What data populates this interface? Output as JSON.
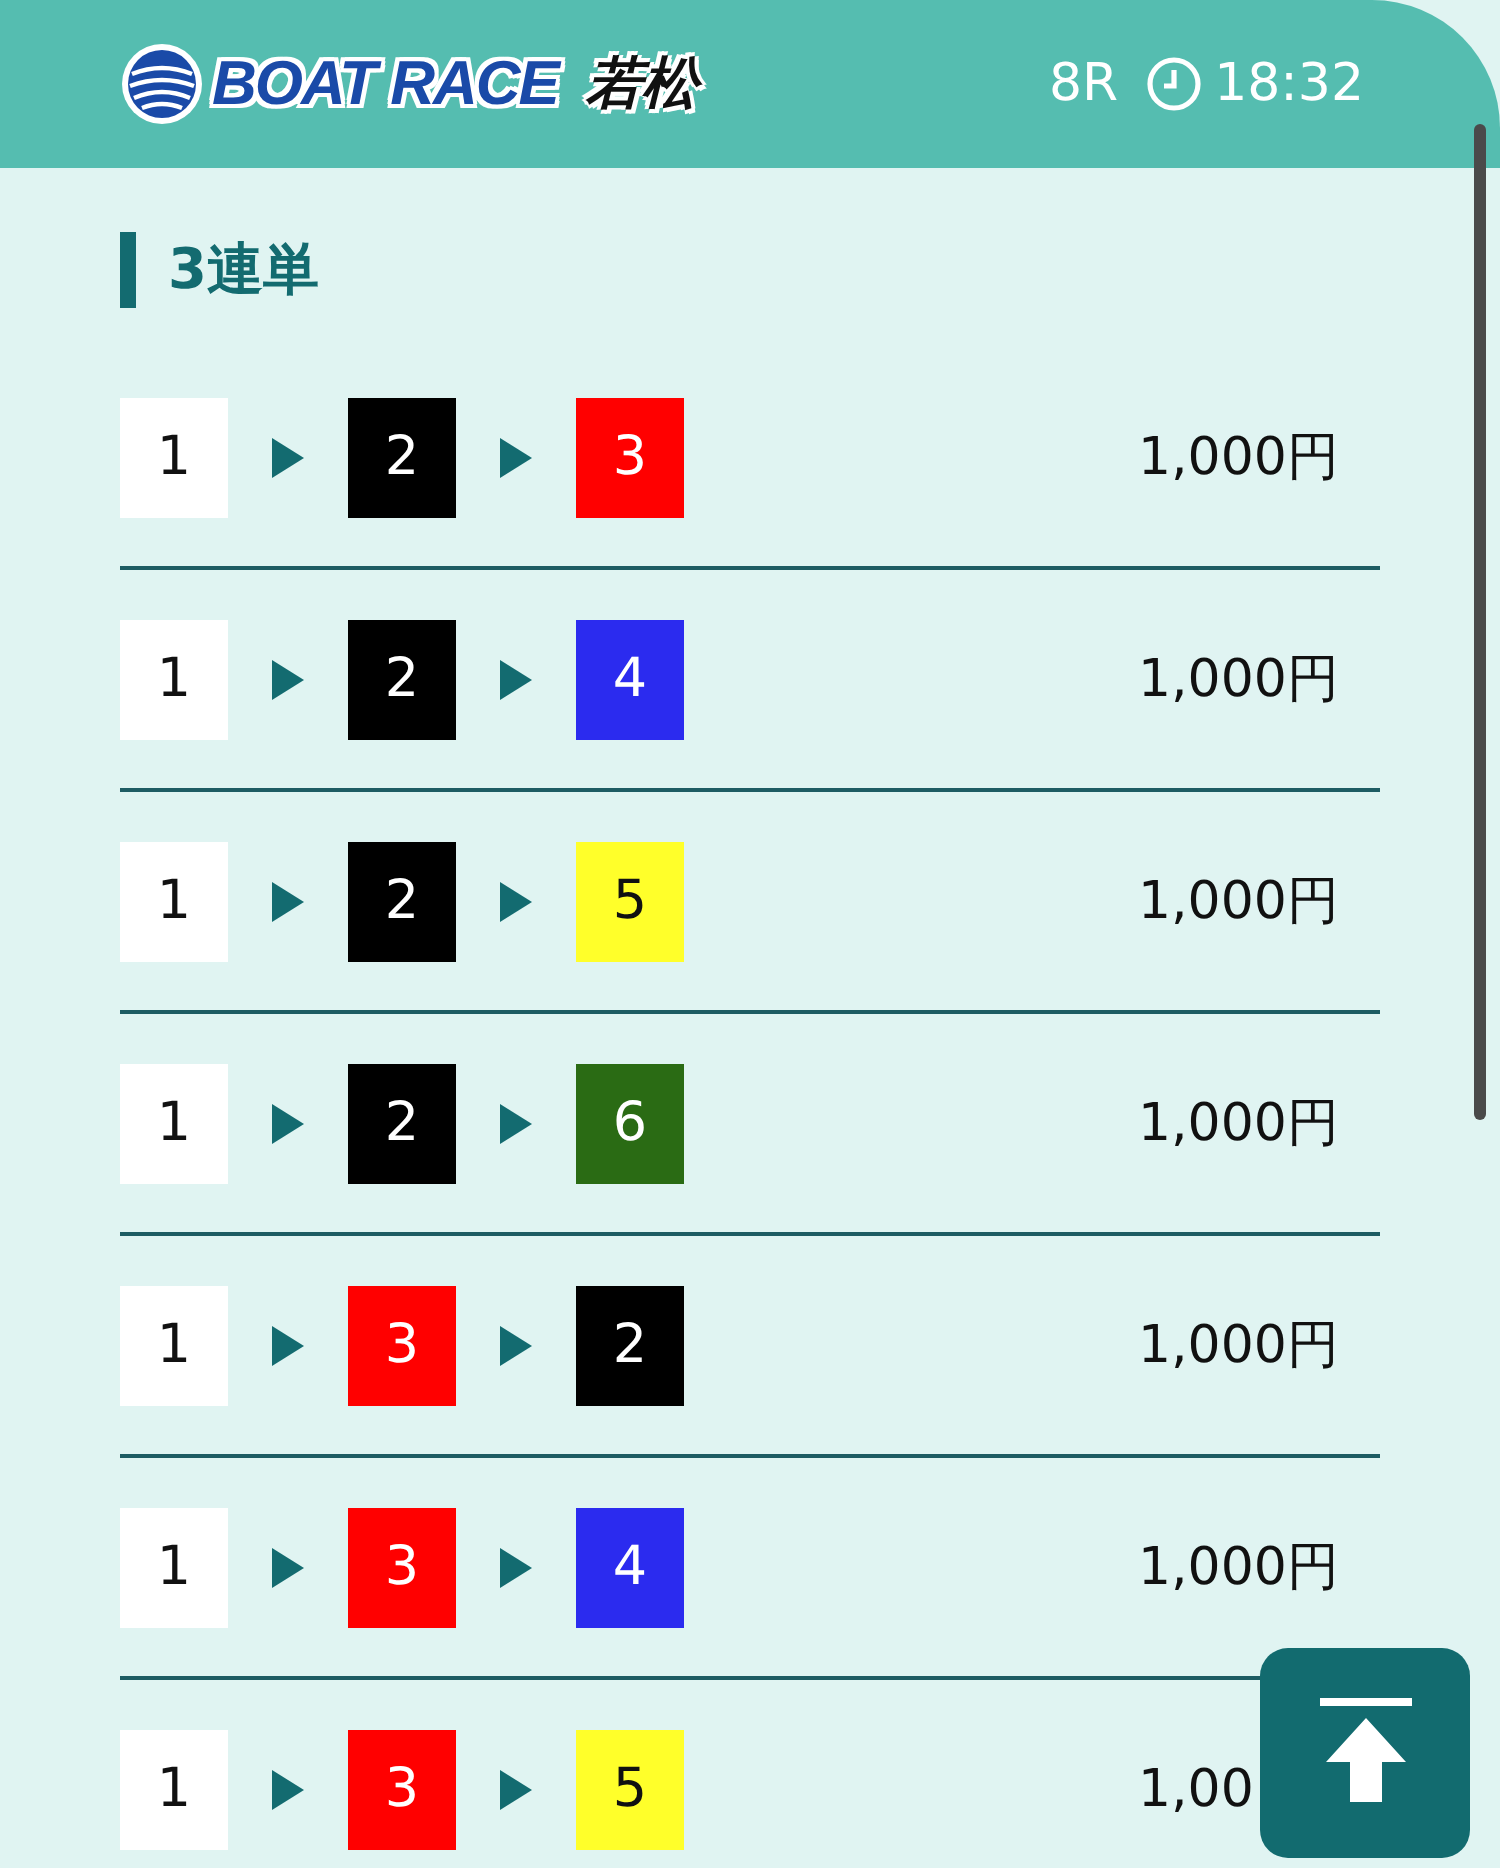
{
  "header": {
    "logo": {
      "brand": "BOAT RACE",
      "venue": "若松"
    },
    "race": "8R",
    "time": "18:32"
  },
  "section_title": "3連単",
  "bets": [
    {
      "boats": [
        {
          "number": "1",
          "color": "#ffffff"
        },
        {
          "number": "2",
          "color": "#000000"
        },
        {
          "number": "3",
          "color": "#ff0000"
        }
      ],
      "amount": "1,000円"
    },
    {
      "boats": [
        {
          "number": "1",
          "color": "#ffffff"
        },
        {
          "number": "2",
          "color": "#000000"
        },
        {
          "number": "4",
          "color": "#2b2bef"
        }
      ],
      "amount": "1,000円"
    },
    {
      "boats": [
        {
          "number": "1",
          "color": "#ffffff"
        },
        {
          "number": "2",
          "color": "#000000"
        },
        {
          "number": "5",
          "color": "#ffff2a"
        }
      ],
      "amount": "1,000円"
    },
    {
      "boats": [
        {
          "number": "1",
          "color": "#ffffff"
        },
        {
          "number": "2",
          "color": "#000000"
        },
        {
          "number": "6",
          "color": "#2a6b14"
        }
      ],
      "amount": "1,000円"
    },
    {
      "boats": [
        {
          "number": "1",
          "color": "#ffffff"
        },
        {
          "number": "3",
          "color": "#ff0000"
        },
        {
          "number": "2",
          "color": "#000000"
        }
      ],
      "amount": "1,000円"
    },
    {
      "boats": [
        {
          "number": "1",
          "color": "#ffffff"
        },
        {
          "number": "3",
          "color": "#ff0000"
        },
        {
          "number": "4",
          "color": "#2b2bef"
        }
      ],
      "amount": "1,000円"
    },
    {
      "boats": [
        {
          "number": "1",
          "color": "#ffffff"
        },
        {
          "number": "3",
          "color": "#ff0000"
        },
        {
          "number": "5",
          "color": "#ffff2a"
        }
      ],
      "amount": "1,00"
    }
  ]
}
